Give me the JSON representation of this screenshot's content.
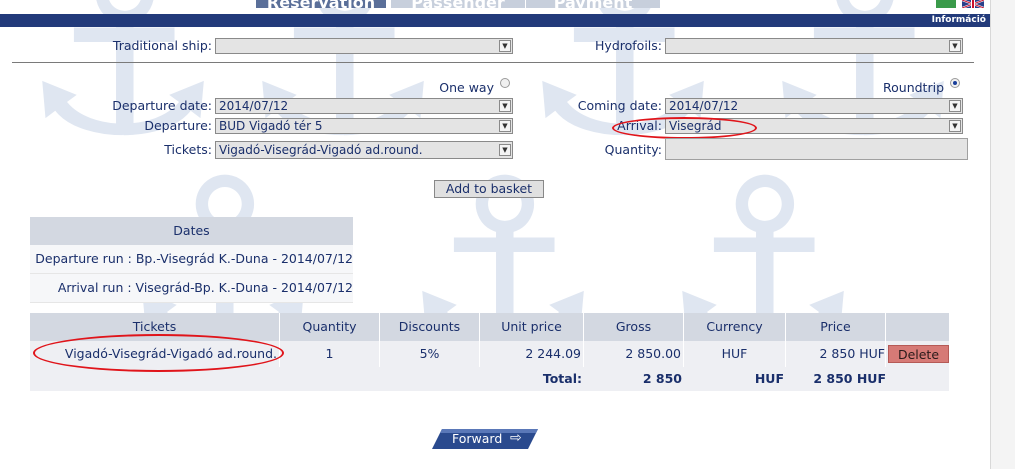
{
  "header": {
    "tabs": [
      {
        "label": "Reservation",
        "active": true
      },
      {
        "label": "Passenger",
        "active": false
      },
      {
        "label": "Payment",
        "active": false
      }
    ],
    "info_link": "Információ"
  },
  "form": {
    "traditional_ship": {
      "label": "Traditional ship:",
      "value": ""
    },
    "hydrofoils": {
      "label": "Hydrofoils:",
      "value": ""
    },
    "one_way": {
      "label": "One way",
      "selected": false
    },
    "roundtrip": {
      "label": "Roundtrip",
      "selected": true
    },
    "departure_date": {
      "label": "Departure date:",
      "value": "2014/07/12"
    },
    "coming_date": {
      "label": "Coming date:",
      "value": "2014/07/12"
    },
    "departure": {
      "label": "Departure:",
      "value": "BUD Vigadó tér 5"
    },
    "arrival": {
      "label": "Arrival:",
      "value": "Visegrád"
    },
    "tickets": {
      "label": "Tickets:",
      "value": "Vigadó-Visegrád-Vigadó ad.round."
    },
    "quantity": {
      "label": "Quantity:",
      "value": ""
    },
    "add_to_basket": "Add to basket"
  },
  "dates": {
    "header": "Dates",
    "rows": [
      "Departure run : Bp.-Visegrád K.-Duna - 2014/07/12",
      "Arrival run : Visegrád-Bp. K.-Duna - 2014/07/12"
    ]
  },
  "tickets_table": {
    "columns": [
      "Tickets",
      "Quantity",
      "Discounts",
      "Unit price",
      "Gross",
      "Currency",
      "Price"
    ],
    "rows": [
      {
        "ticket": "Vigadó-Visegrád-Vigadó ad.round.",
        "quantity": "1",
        "discount": "5%",
        "unit_price": "2 244.09",
        "gross": "2 850.00",
        "currency": "HUF",
        "price": "2 850 HUF",
        "delete_label": "Delete"
      }
    ],
    "total": {
      "label": "Total:",
      "gross": "2 850",
      "currency": "HUF",
      "price": "2 850 HUF"
    }
  },
  "forward_label": "Forward",
  "colors": {
    "accent": "#223a7a",
    "highlight": "#e0141a",
    "delete": "#d67a76"
  }
}
